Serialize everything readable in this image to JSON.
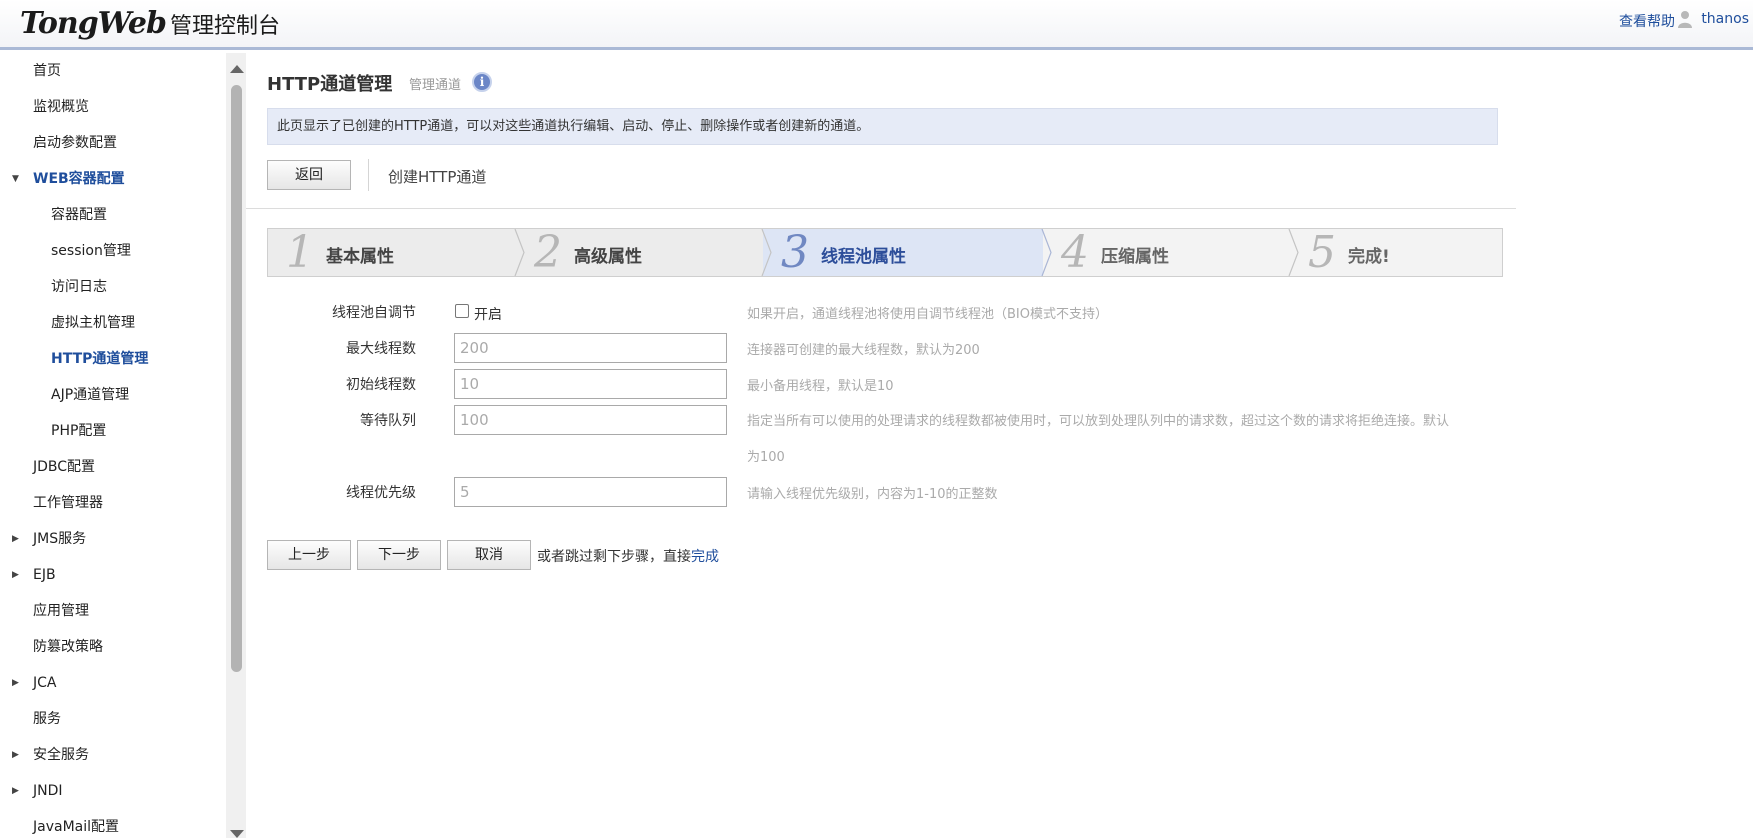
{
  "header": {
    "logo": "TongWeb",
    "logo_suffix": "管理控制台",
    "help_link": "查看帮助",
    "user": "thanos"
  },
  "sidebar": {
    "items": [
      {
        "label": "首页"
      },
      {
        "label": "监视概览"
      },
      {
        "label": "启动参数配置"
      },
      {
        "label": "WEB容器配置",
        "expanded": true
      },
      {
        "label": "容器配置"
      },
      {
        "label": "session管理"
      },
      {
        "label": "访问日志"
      },
      {
        "label": "虚拟主机管理"
      },
      {
        "label": "HTTP通道管理",
        "selected": true
      },
      {
        "label": "AJP通道管理"
      },
      {
        "label": "PHP配置"
      },
      {
        "label": "JDBC配置"
      },
      {
        "label": "工作管理器"
      },
      {
        "label": "JMS服务"
      },
      {
        "label": "EJB"
      },
      {
        "label": "应用管理"
      },
      {
        "label": "防篡改策略"
      },
      {
        "label": "JCA"
      },
      {
        "label": "服务"
      },
      {
        "label": "安全服务"
      },
      {
        "label": "JNDI"
      },
      {
        "label": "JavaMail配置"
      }
    ]
  },
  "page": {
    "title": "HTTP通道管理",
    "subtitle": "管理通道",
    "info_icon": "i",
    "description": "此页显示了已创建的HTTP通道，可以对这些通道执行编辑、启动、停止、删除操作或者创建新的通道。",
    "back_label": "返回",
    "breadcrumb": "创建HTTP通道"
  },
  "wizard": {
    "current_step": 3,
    "steps": [
      {
        "num": "1",
        "label": "基本属性"
      },
      {
        "num": "2",
        "label": "高级属性"
      },
      {
        "num": "3",
        "label": "线程池属性"
      },
      {
        "num": "4",
        "label": "压缩属性"
      },
      {
        "num": "5",
        "label": "完成!"
      }
    ]
  },
  "form": {
    "autoscale": {
      "label": "线程池自调节",
      "checkbox_label": "开启",
      "checked": false,
      "hint": "如果开启，通道线程池将使用自调节线程池（BIO模式不支持）"
    },
    "max_threads": {
      "label": "最大线程数",
      "placeholder": "200",
      "hint": "连接器可创建的最大线程数，默认为200"
    },
    "min_threads": {
      "label": "初始线程数",
      "placeholder": "10",
      "hint": "最小备用线程，默认是10"
    },
    "queue": {
      "label": "等待队列",
      "placeholder": "100",
      "hint_line1": "指定当所有可以使用的处理请求的线程数都被使用时，可以放到处理队列中的请求数，超过这个数的请求将拒绝连接。默认",
      "hint_line2": "为100"
    },
    "priority": {
      "label": "线程优先级",
      "placeholder": "5",
      "hint": "请输入线程优先级别，内容为1-10的正整数"
    }
  },
  "actions": {
    "prev": "上一步",
    "next": "下一步",
    "cancel": "取消",
    "skip_text": "或者跳过剩下步骤，直接",
    "finish_link": "完成"
  },
  "colors": {
    "accent": "#1f4e9c",
    "desc_bg": "#e6ebf7",
    "current_step_bg": "#dde5f5"
  }
}
